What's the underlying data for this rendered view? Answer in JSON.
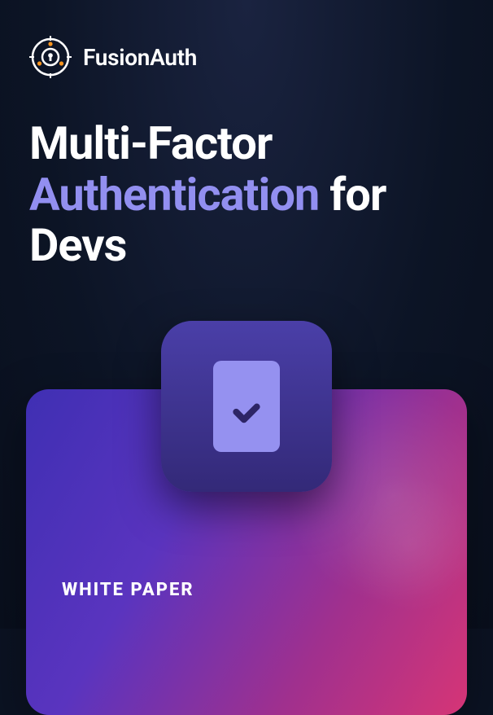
{
  "brand": {
    "name": "FusionAuth"
  },
  "title": {
    "part1": "Multi-Factor",
    "accent": "Authentication",
    "part2": "for",
    "part3": "Devs"
  },
  "doc_type": "WHITE PAPER",
  "colors": {
    "accent_text": "#928ff0",
    "brand_orange": "#f7941e",
    "background_dark": "#0c1425",
    "icon_tile": "#4a3fa8",
    "card_icon": "#9591f0",
    "gradient_start": "#3f2fb3",
    "gradient_end": "#d63576"
  }
}
